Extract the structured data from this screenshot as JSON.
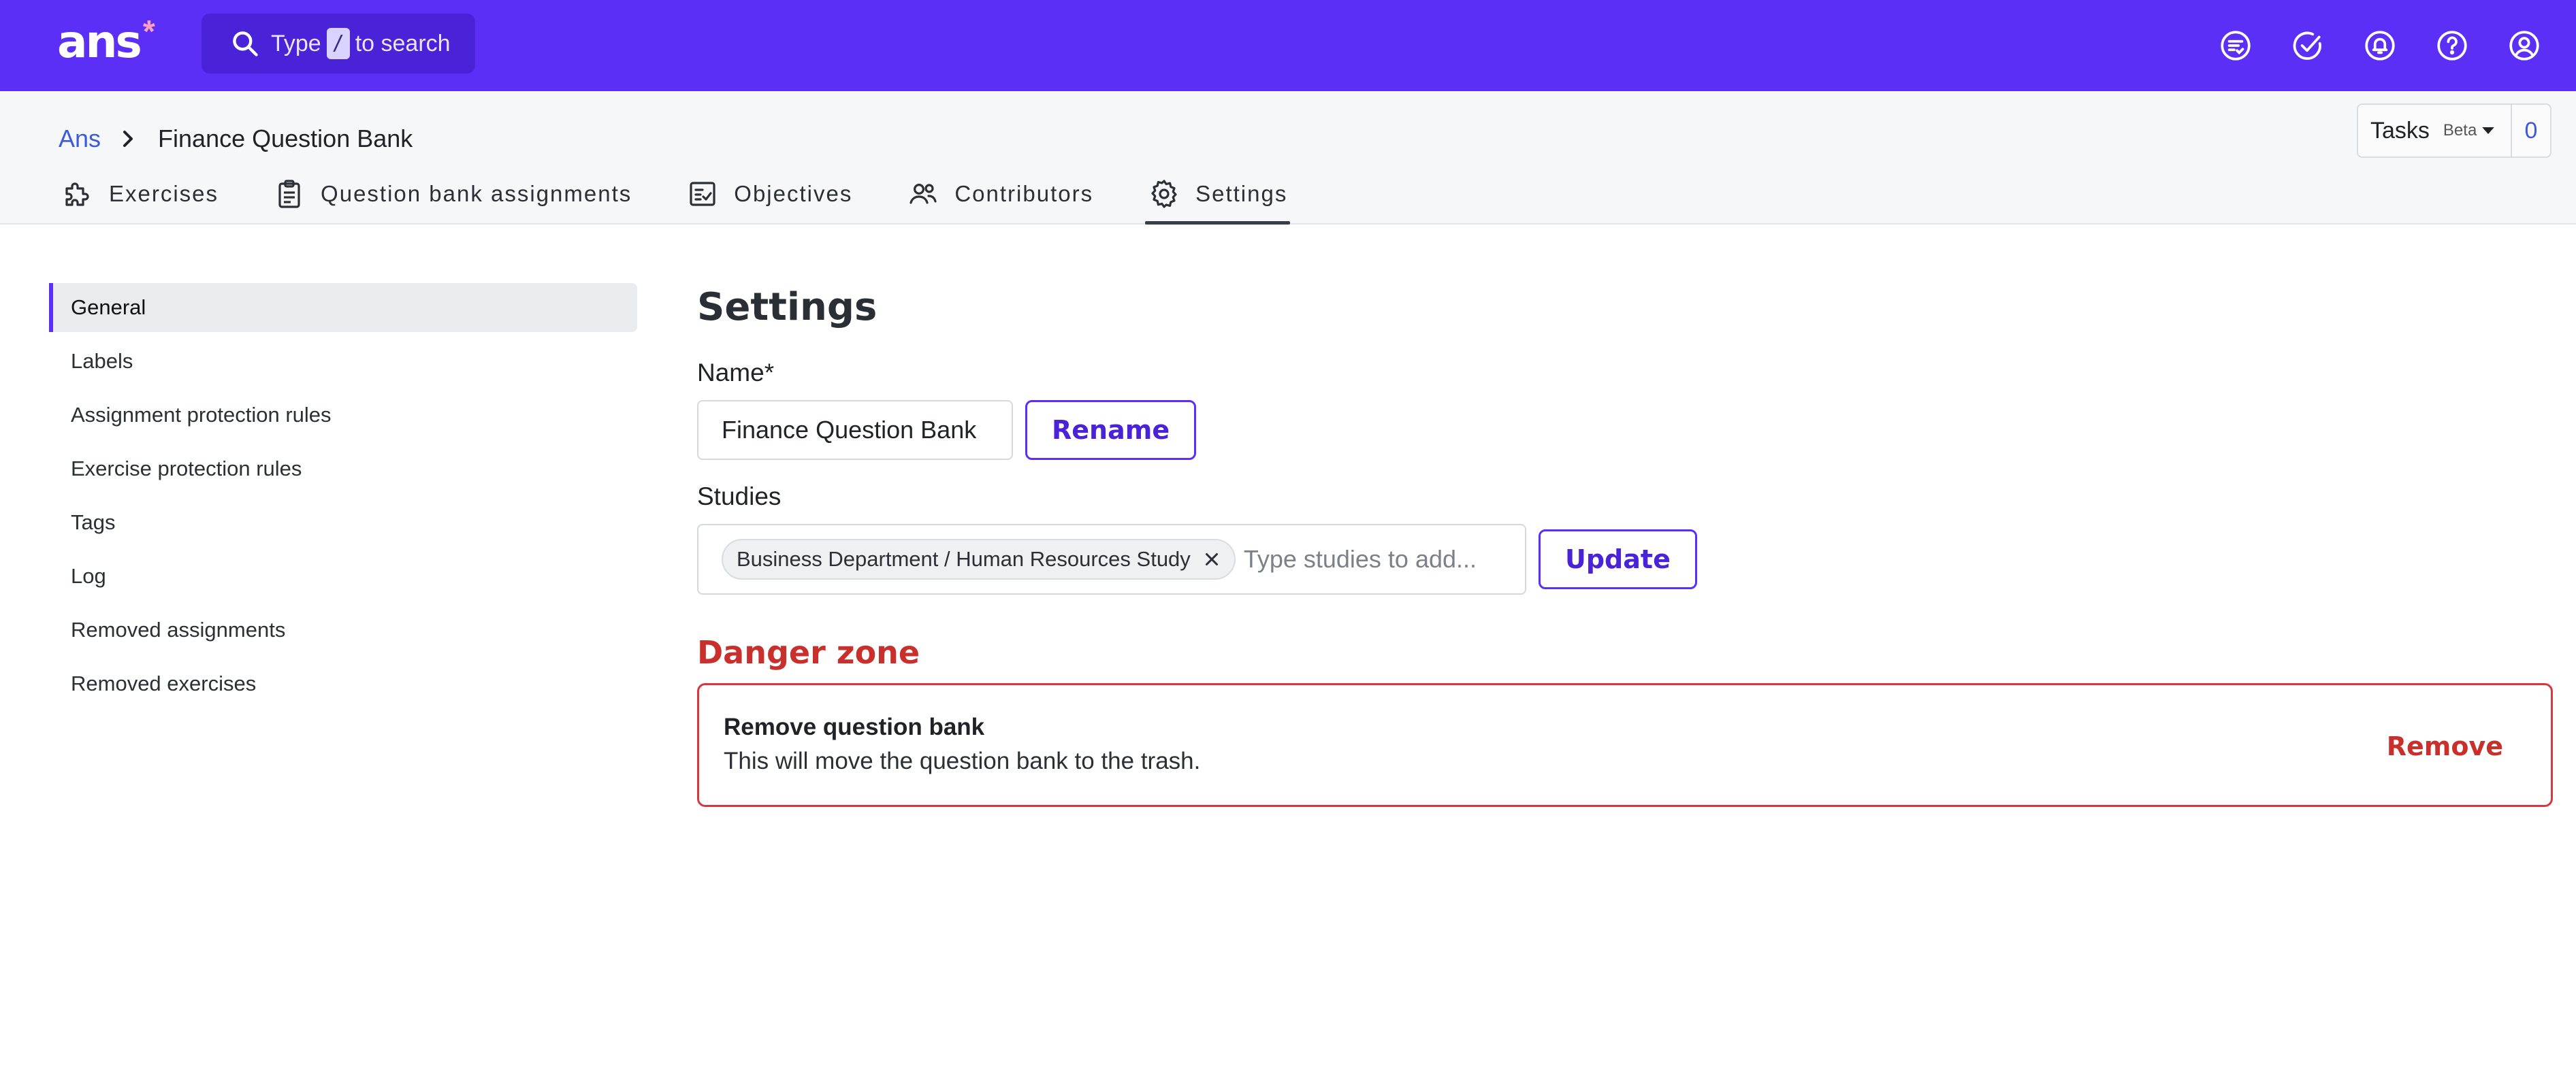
{
  "topbar": {
    "logo_text": "ans",
    "logo_star": "*",
    "search": {
      "prefix": "Type",
      "key": "/",
      "suffix": "to search"
    },
    "icons": [
      "task-list-icon",
      "check-circle-icon",
      "bell-icon",
      "help-icon",
      "account-icon"
    ]
  },
  "breadcrumb": {
    "root": "Ans",
    "current": "Finance Question Bank"
  },
  "tasks": {
    "label": "Tasks",
    "badge": "Beta",
    "count": "0"
  },
  "tabs": [
    {
      "label": "Exercises",
      "icon": "puzzle-icon"
    },
    {
      "label": "Question bank assignments",
      "icon": "clipboard-icon"
    },
    {
      "label": "Objectives",
      "icon": "checklist-icon"
    },
    {
      "label": "Contributors",
      "icon": "people-icon"
    },
    {
      "label": "Settings",
      "icon": "gear-icon",
      "active": true
    }
  ],
  "sidebar": {
    "items": [
      {
        "label": "General",
        "active": true
      },
      {
        "label": "Labels"
      },
      {
        "label": "Assignment protection rules"
      },
      {
        "label": "Exercise protection rules"
      },
      {
        "label": "Tags"
      },
      {
        "label": "Log"
      },
      {
        "label": "Removed assignments"
      },
      {
        "label": "Removed exercises"
      }
    ]
  },
  "main": {
    "title": "Settings",
    "name_label": "Name*",
    "name_value": "Finance Question Bank",
    "rename_label": "Rename",
    "studies_label": "Studies",
    "study_chip": "Business Department / Human Resources Study",
    "studies_placeholder": "Type studies to add...",
    "update_label": "Update",
    "danger": {
      "title": "Danger zone",
      "heading": "Remove question bank",
      "description": "This will move the question bank to the trash.",
      "action_label": "Remove"
    }
  },
  "colors": {
    "brand": "#5b2ff6",
    "danger": "#c9302c",
    "link": "#3b5bdb"
  }
}
